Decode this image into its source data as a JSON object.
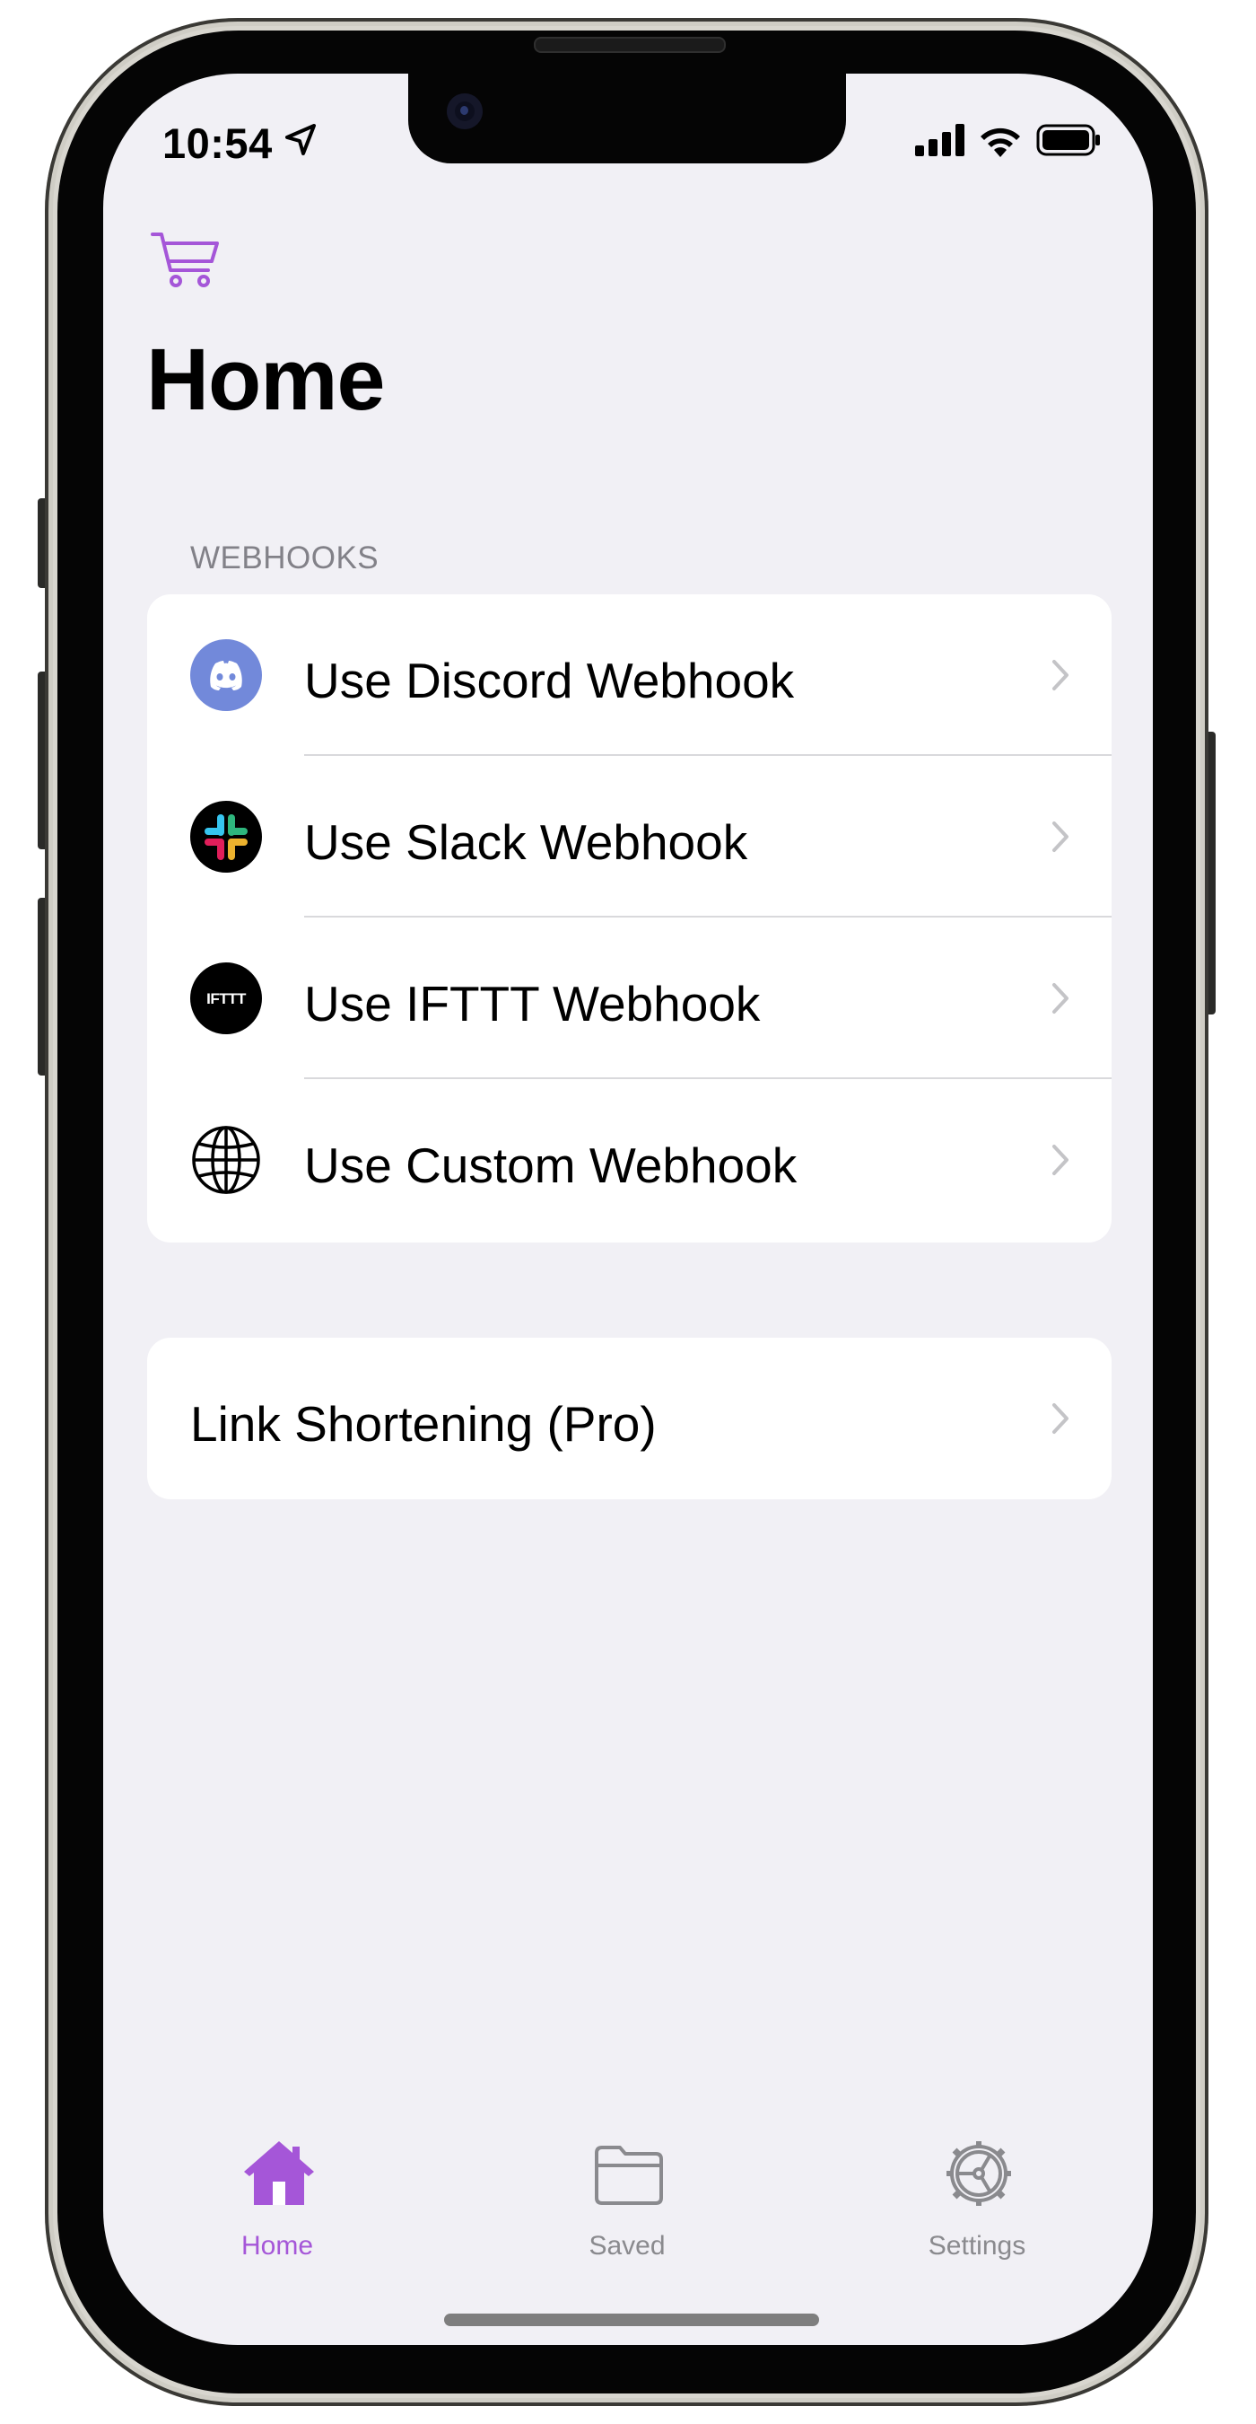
{
  "status_bar": {
    "time": "10:54"
  },
  "nav": {
    "cart_icon": "cart-icon",
    "title": "Home"
  },
  "sections": {
    "webhooks_header": "WEBHOOKS",
    "webhooks": [
      {
        "label": "Use Discord Webhook",
        "icon": "discord-icon"
      },
      {
        "label": "Use Slack Webhook",
        "icon": "slack-icon"
      },
      {
        "label": "Use IFTTT Webhook",
        "icon": "ifttt-icon"
      },
      {
        "label": "Use Custom Webhook",
        "icon": "globe-icon"
      }
    ],
    "other": [
      {
        "label": "Link Shortening (Pro)"
      }
    ]
  },
  "icon_texts": {
    "ifttt": "IFTTT"
  },
  "tab_bar": {
    "selected": "Home",
    "tabs": [
      {
        "label": "Home",
        "icon": "house-icon"
      },
      {
        "label": "Saved",
        "icon": "folder-icon"
      },
      {
        "label": "Settings",
        "icon": "gear-icon"
      }
    ]
  },
  "colors": {
    "accent": "#A556D8",
    "background": "#F1F0F5",
    "discord": "#7289DA",
    "chevron": "#C4C4C7",
    "tab_inactive": "#8A8A8E"
  }
}
